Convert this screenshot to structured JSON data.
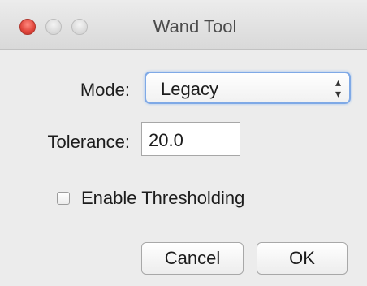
{
  "window": {
    "title": "Wand Tool"
  },
  "form": {
    "mode_label": "Mode:",
    "mode_value": "Legacy",
    "tolerance_label": "Tolerance:",
    "tolerance_value": "20.0",
    "thresholding_label": "Enable Thresholding",
    "thresholding_checked": false
  },
  "buttons": {
    "cancel_label": "Cancel",
    "ok_label": "OK"
  },
  "icons": {
    "close": "close-icon",
    "minimize": "minimize-icon",
    "zoom": "zoom-icon",
    "select_arrows": "chevron-up-down-icon"
  },
  "colors": {
    "close_button": "#e0443a",
    "focus_ring": "#7fa9e6",
    "window_background": "#ececec"
  }
}
